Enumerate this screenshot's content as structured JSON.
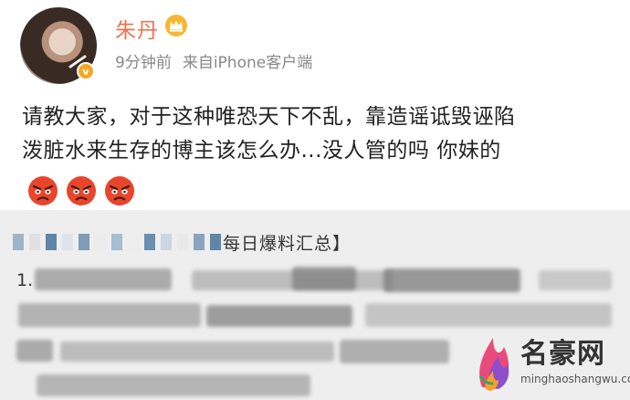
{
  "post": {
    "username": "朱丹",
    "time": "9分钟前",
    "source": "来自iPhone客户端",
    "content_line1": "请教大家，对于这种唯恐天下不乱，靠造谣诋毁诬陷",
    "content_line2": "泼脏水来生存的博主该怎么办...没人管的吗 你妹的",
    "emojis": [
      "angry-face-icon",
      "angry-face-icon",
      "angry-face-icon"
    ]
  },
  "repost": {
    "title_suffix": "每日爆料汇总】",
    "first_item_prefix": "1."
  },
  "watermark": {
    "name": "名豪网",
    "url": "minghaoshangwu.com"
  },
  "colors": {
    "username": "#eb7350",
    "meta": "#888888",
    "repost_bg": "#eeeeee",
    "badge": "#f6a623"
  }
}
